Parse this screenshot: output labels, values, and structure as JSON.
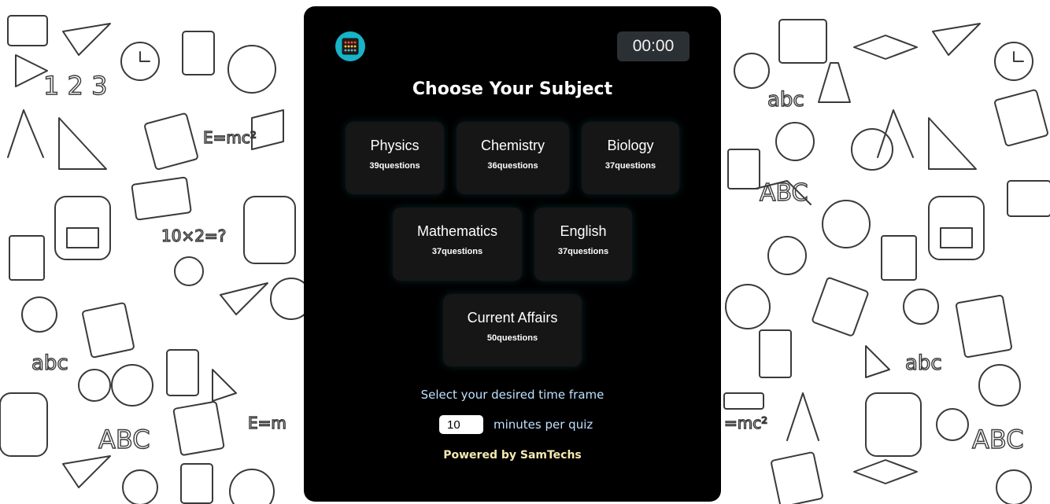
{
  "app": {
    "logo_icon": "abacus-icon",
    "timer": "00:00",
    "heading": "Choose Your Subject"
  },
  "subjects": [
    {
      "name": "Physics",
      "count": "39questions"
    },
    {
      "name": "Chemistry",
      "count": "36questions"
    },
    {
      "name": "Biology",
      "count": "37questions"
    },
    {
      "name": "Mathematics",
      "count": "37questions"
    },
    {
      "name": "English",
      "count": "37questions"
    },
    {
      "name": "Current Affairs",
      "count": "50questions"
    }
  ],
  "timeframe": {
    "prompt": "Select your desired time frame",
    "minutes_value": "10",
    "minutes_label": "minutes per quiz"
  },
  "footer": {
    "powered_by": "Powered by SamTechs"
  },
  "colors": {
    "card_bg": "#000000",
    "subject_bg": "#161616",
    "logo_bg": "#17b4c8",
    "timer_bg": "#2b3035",
    "prompt_text": "#bfe0ff",
    "footer_text": "#f5e9b0"
  }
}
